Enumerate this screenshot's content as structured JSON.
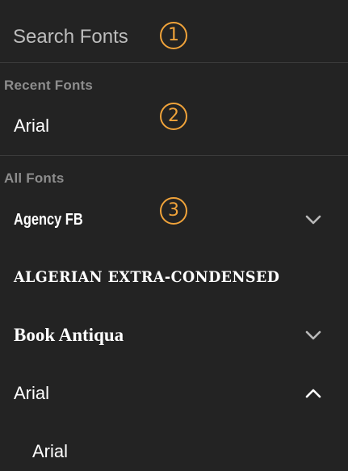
{
  "search": {
    "placeholder": "Search Fonts",
    "callout": "1"
  },
  "recent": {
    "label": "Recent Fonts",
    "callout": "2",
    "items": [
      {
        "label": "Arial"
      }
    ]
  },
  "all": {
    "label": "All Fonts",
    "callout": "3",
    "items": [
      {
        "label": "Agency FB",
        "expander": "chevron-down-icon"
      },
      {
        "label": "ALGERIAN EXTRA-CONDENSED"
      },
      {
        "label": "Book Antiqua",
        "expander": "chevron-down-icon"
      },
      {
        "label": "Arial",
        "expander": "chevron-up-icon",
        "expanded": true
      },
      {
        "label": "Arial",
        "sub": true
      }
    ]
  },
  "colors": {
    "background": "#232323",
    "accent_callout": "#f0a33a",
    "section_label": "#8d8d8d",
    "text": "#ffffff"
  }
}
